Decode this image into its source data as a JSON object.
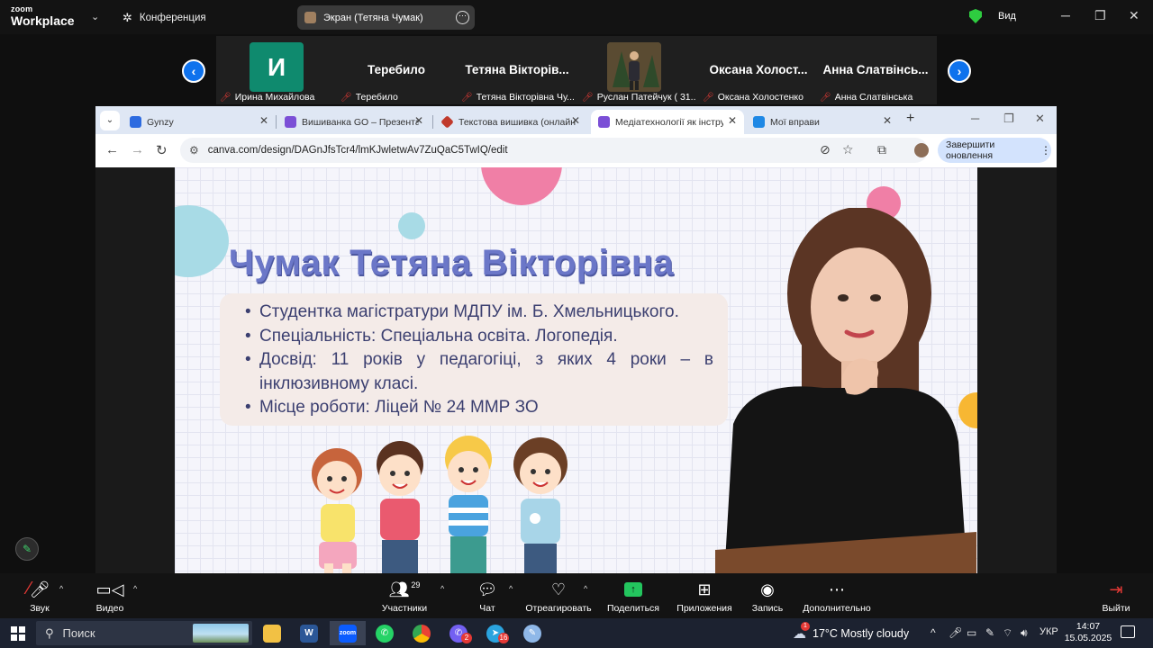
{
  "zoom": {
    "logo_small": "zoom",
    "logo_big": "Workplace",
    "conference_label": "Конференция",
    "screen_share_label": "Экран (Тетяна Чумак)",
    "view_label": "Вид"
  },
  "participants": [
    {
      "initial": "И",
      "label": "Ирина Михайлова"
    },
    {
      "name": "Теребило",
      "label": "Теребило"
    },
    {
      "name": "Тетяна Вікторів...",
      "label": "Тетяна Вікторівна Чу..."
    },
    {
      "label": "Руслан  Патейчук ( 31..."
    },
    {
      "name": "Оксана  Холост...",
      "label": "Оксана Холостенко"
    },
    {
      "name": "Анна Слатвінсь...",
      "label": "Анна Слатвінська"
    }
  ],
  "browser": {
    "tabs": [
      {
        "title": "Gynzy",
        "color": "#2d6be0"
      },
      {
        "title": "Вишиванка GO – Презентац",
        "color": "#7b4fd6"
      },
      {
        "title": "Текстова вишивка (онлайн)",
        "color": "#c0392b"
      },
      {
        "title": "Медіатехнології як інструм",
        "color": "#7b4fd6",
        "active": true
      },
      {
        "title": "Мої вправи",
        "color": "#1e88e5"
      }
    ],
    "url": "canva.com/design/DAGnJfsTcr4/lmKJwletwAv7ZuQaC5TwIQ/edit",
    "update_button": "Завершити оновлення"
  },
  "slide": {
    "title": "Чумак Тетяна Вікторівна",
    "bullets": [
      "Студентка магістратури МДПУ ім. Б. Хмельницького.",
      "Спеціальність: Спеціальна освіта. Логопедія.",
      "Досвід: 11 років у педагогіці, з яких 4 роки – в інклюзивному класі.",
      "Місце роботи: Ліцей № 24 ММР ЗО"
    ]
  },
  "toolbar": {
    "audio": "Звук",
    "video": "Видео",
    "participants": "Участники",
    "participants_count": "29",
    "chat": "Чат",
    "react": "Отреагировать",
    "share": "Поделиться",
    "apps": "Приложения",
    "record": "Запись",
    "more": "Дополнительно",
    "leave": "Выйти"
  },
  "taskbar": {
    "search_placeholder": "Поиск",
    "viber_badge": "2",
    "telegram_badge": "16",
    "weather_badge": "1",
    "weather": "17°C  Mostly cloudy",
    "language": "УКР",
    "time": "14:07",
    "date": "15.05.2025"
  }
}
